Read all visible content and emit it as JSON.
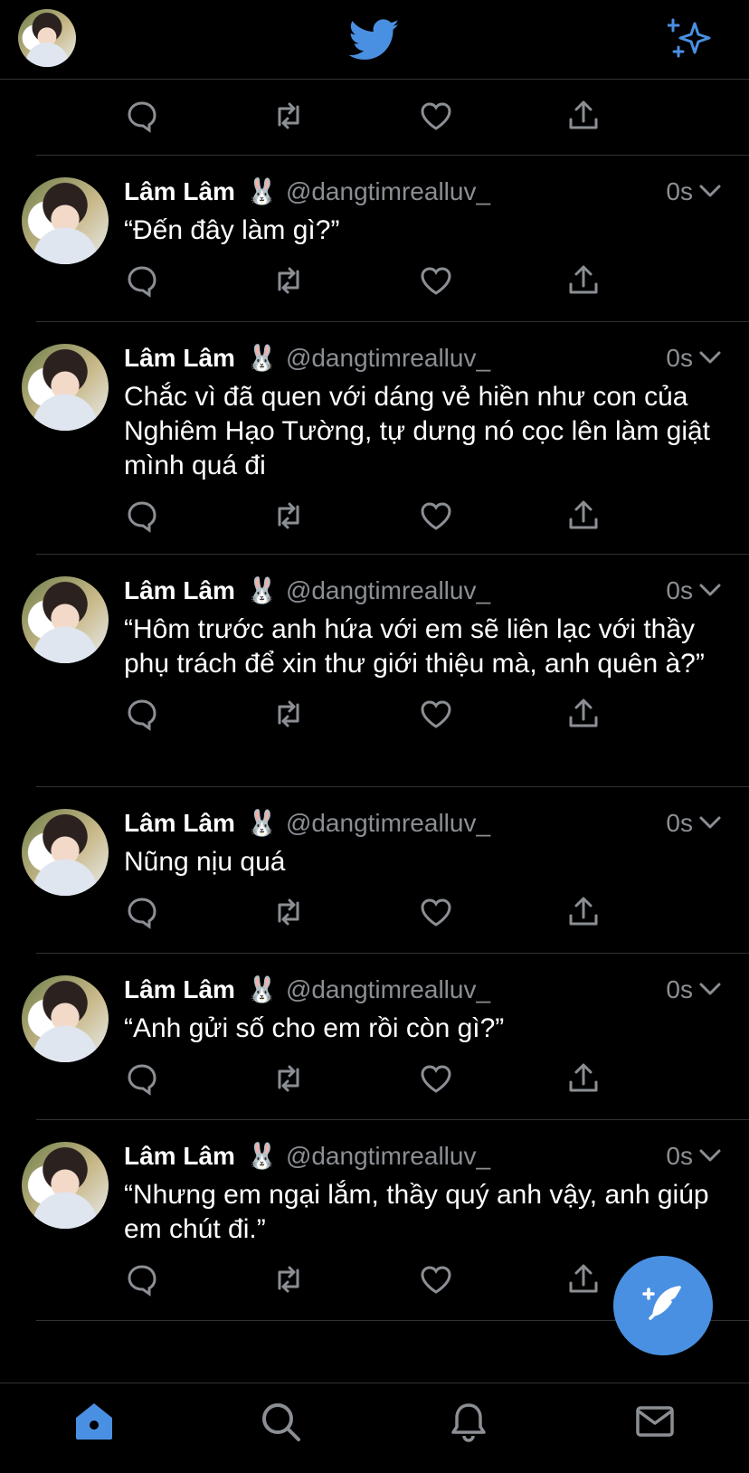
{
  "header": {
    "avatar_icon": "profile-avatar",
    "logo_icon": "twitter-bird-icon",
    "sparkle_icon": "sparkle-icon",
    "accent_color": "#4a90e2"
  },
  "tweets": [
    {
      "name": "Lâm Lâm",
      "emoji": "🐰",
      "handle": "@dangtimrealluv_",
      "time": "0s",
      "text": "“Đến đây làm gì?”"
    },
    {
      "name": "Lâm Lâm",
      "emoji": "🐰",
      "handle": "@dangtimrealluv_",
      "time": "0s",
      "text": "Chắc vì đã quen với dáng vẻ hiền như con của Nghiêm Hạo Tường, tự dưng nó cọc lên làm giật mình quá đi"
    },
    {
      "name": "Lâm Lâm",
      "emoji": "🐰",
      "handle": "@dangtimrealluv_",
      "time": "0s",
      "text": "“Hôm trước anh hứa với em sẽ liên lạc với thầy phụ trách để xin thư giới thiệu mà, anh quên à?”"
    },
    {
      "name": "Lâm Lâm",
      "emoji": "🐰",
      "handle": "@dangtimrealluv_",
      "time": "0s",
      "text": "Nũng nịu quá"
    },
    {
      "name": "Lâm Lâm",
      "emoji": "🐰",
      "handle": "@dangtimrealluv_",
      "time": "0s",
      "text": "“Anh gửi số cho em rồi còn gì?”"
    },
    {
      "name": "Lâm Lâm",
      "emoji": "🐰",
      "handle": "@dangtimrealluv_",
      "time": "0s",
      "text": "“Nhưng em ngại lắm, thầy quý anh vậy, anh giúp em chút đi.”"
    }
  ],
  "fab": {
    "icon": "compose-tweet-icon"
  },
  "bottom_nav": {
    "items": [
      "home-icon",
      "search-icon",
      "notifications-icon",
      "messages-icon"
    ],
    "active": "home-icon"
  }
}
